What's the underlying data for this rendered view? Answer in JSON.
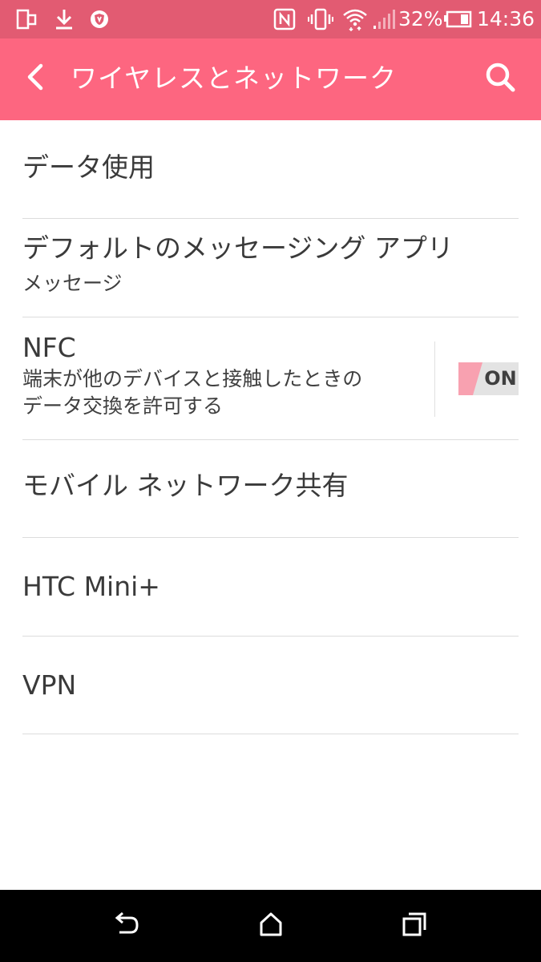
{
  "status_bar": {
    "icons": [
      "screen-mirror-icon",
      "download-icon",
      "shield-icon",
      "nfc-icon",
      "vibrate-icon",
      "wifi-icon",
      "signal-icon",
      "battery-icon"
    ],
    "battery_percent": "32%",
    "time": "14:36"
  },
  "app_bar": {
    "title": "ワイヤレスとネットワーク",
    "back_icon": "back-arrow-icon",
    "search_icon": "search-icon"
  },
  "items": [
    {
      "title": "データ使用"
    },
    {
      "title": "デフォルトのメッセージング アプリ",
      "subtitle": "メッセージ"
    },
    {
      "title": "NFC",
      "subtitle_line1": "端末が他のデバイスと接触したときの",
      "subtitle_line2": "データ交換を許可する",
      "toggle": "ON"
    },
    {
      "title": "モバイル ネットワーク共有"
    },
    {
      "title": "HTC Mini+"
    },
    {
      "title": "VPN"
    }
  ],
  "nav_bar": {
    "icons": [
      "back-icon",
      "home-icon",
      "recents-icon"
    ]
  },
  "colors": {
    "status_bar": "#e25b72",
    "app_bar": "#fd6680",
    "toggle_accent": "#f8a1b0"
  }
}
